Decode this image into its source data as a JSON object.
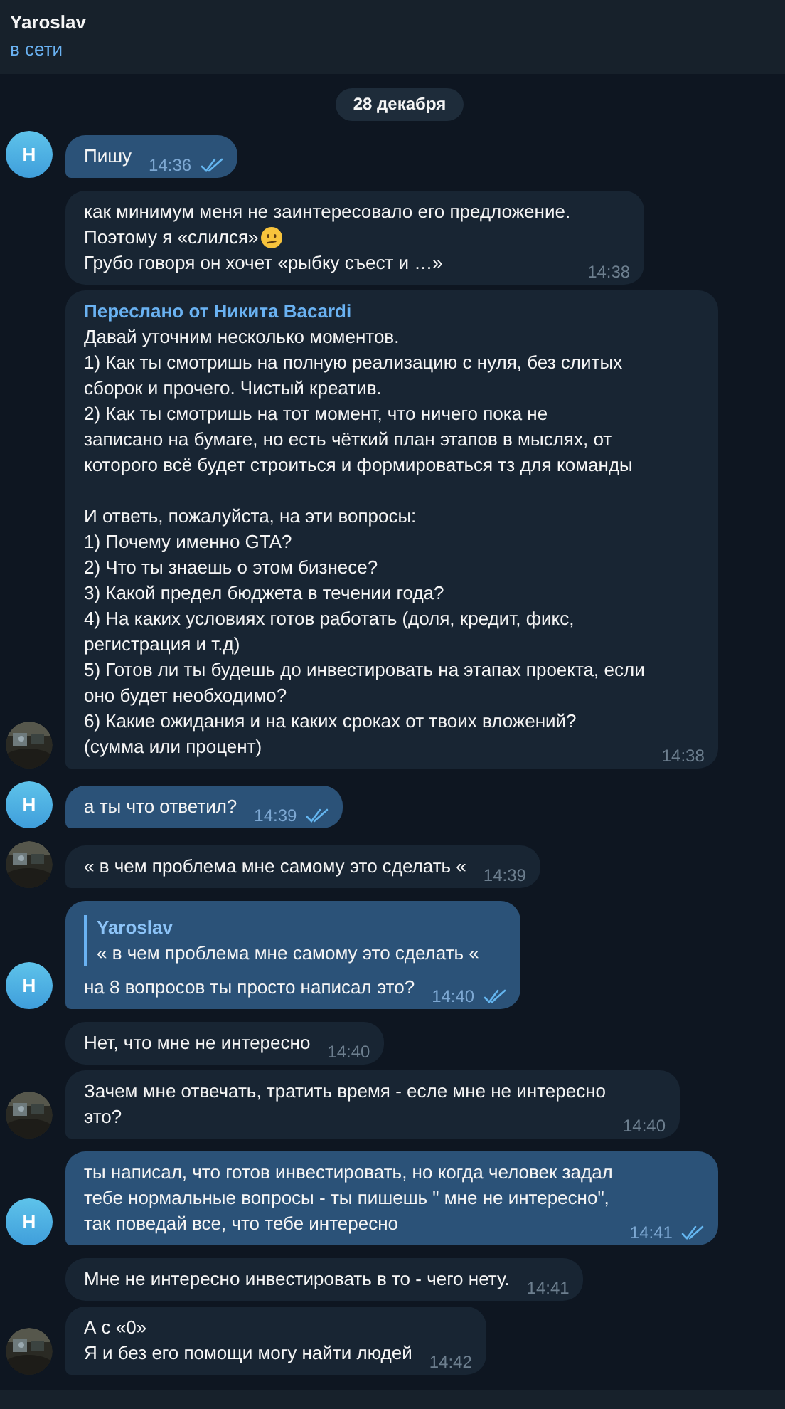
{
  "header": {
    "title": "Yaroslav",
    "status": "в сети"
  },
  "date_badge": "28 декабря",
  "messages": [
    {
      "kind": "outgoing",
      "parts": [
        {
          "text": "Пишу"
        }
      ],
      "time": "14:36",
      "read": true,
      "avatar": {
        "kind": "letter",
        "letter": "Н"
      }
    },
    {
      "kind": "incoming",
      "parts": [
        {
          "text": "как минимум меня не заинтересовало его предложение."
        },
        {
          "text": "Поэтому я «слился»",
          "emoji_after": true
        },
        {
          "text": "Грубо говоря он хочет «рыбку съест и …»"
        }
      ],
      "time": "14:38"
    },
    {
      "kind": "incoming",
      "forwarded_from": "Переслано от Никита Bacardi",
      "parts": [
        {
          "text": "Давай уточним несколько моментов.\n1) Как ты смотришь на полную реализацию с нуля, без слитых\nсборок и прочего. Чистый креатив.\n2) Как ты смотришь на тот момент, что ничего пока не\nзаписано на бумаге, но есть чёткий план этапов в мыслях, от\nкоторого всё будет строиться и формироваться тз для команды\n\nИ ответь, пожалуйста, на эти вопросы:\n1) Почему именно GTA?\n2) Что ты знаешь о этом бизнесе?\n3) Какой предел бюджета в течении года?\n4) На каких условиях готов работать (доля, кредит, фикс,\nрегистрация и т.д)\n5) Готов ли ты будешь до инвестировать на этапах проекта, если\nоно будет необходимо?\n6) Какие ожидания и на каких сроках от твоих вложений?\n(сумма или процент)"
        }
      ],
      "time": "14:38"
    },
    {
      "kind": "outgoing",
      "parts": [
        {
          "text": "а ты что ответил?"
        }
      ],
      "time": "14:39",
      "read": true,
      "avatar": {
        "kind": "letter",
        "letter": "Н"
      }
    },
    {
      "kind": "incoming",
      "parts": [
        {
          "text": "« в чем проблема мне самому это сделать «"
        }
      ],
      "time": "14:39"
    },
    {
      "kind": "outgoing",
      "reply": {
        "name": "Yaroslav",
        "text": "« в чем проблема мне самому это сделать «"
      },
      "parts": [
        {
          "text": "на 8 вопросов ты просто написал это?"
        }
      ],
      "time": "14:40",
      "read": true,
      "avatar": {
        "kind": "letter",
        "letter": "Н"
      }
    },
    {
      "kind": "incoming",
      "parts": [
        {
          "text": "Нет, что мне не интересно"
        }
      ],
      "time": "14:40"
    },
    {
      "kind": "incoming",
      "parts": [
        {
          "text": "Зачем мне отвечать, тратить время - еслe мне не интересно\nэто?"
        }
      ],
      "time": "14:40"
    },
    {
      "kind": "outgoing",
      "parts": [
        {
          "text": "ты написал, что готов инвестировать, но когда человек задал\nтебе нормальные вопросы - ты пишешь \" мне не интересно\",\nтак поведай все, что тебе интересно"
        }
      ],
      "time": "14:41",
      "read": true,
      "avatar": {
        "kind": "letter",
        "letter": "Н"
      }
    },
    {
      "kind": "incoming",
      "parts": [
        {
          "text": "Мне не интересно инвестировать в то - чего нету."
        }
      ],
      "time": "14:41"
    },
    {
      "kind": "incoming",
      "parts": [
        {
          "text": "А с «0»\nЯ и без его помощи могу найти людей"
        }
      ],
      "time": "14:42"
    }
  ]
}
